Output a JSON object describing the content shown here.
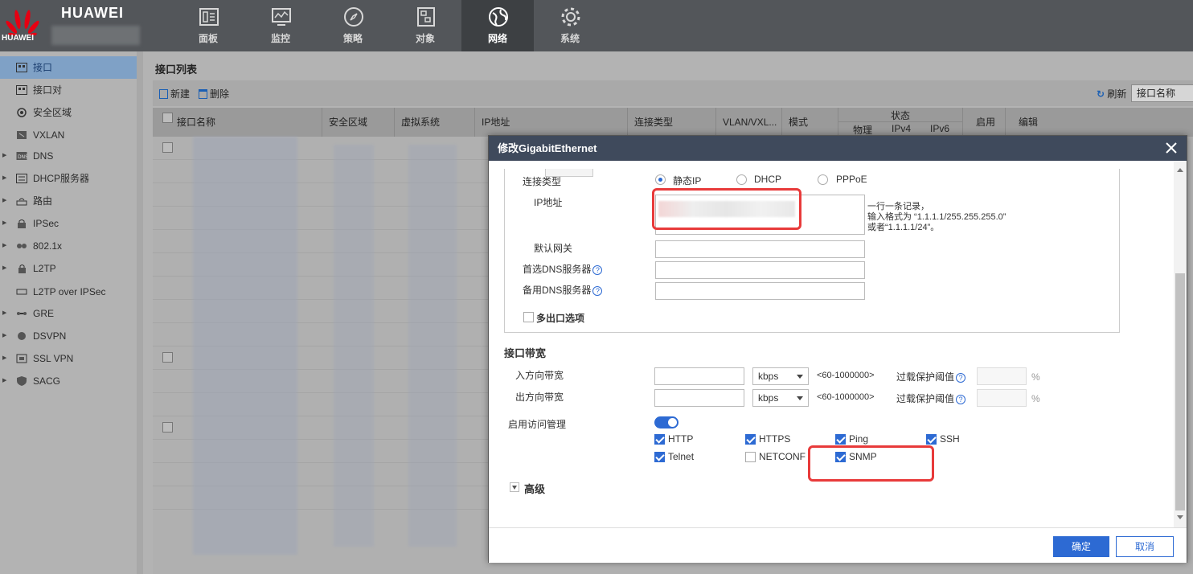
{
  "topbar": {
    "logo_text": "HUAWEI",
    "brand": "HUAWEI",
    "nav": [
      {
        "label": "面板",
        "icon": "dashboard-icon"
      },
      {
        "label": "监控",
        "icon": "monitor-icon"
      },
      {
        "label": "策略",
        "icon": "compass-icon"
      },
      {
        "label": "对象",
        "icon": "object-icon"
      },
      {
        "label": "网络",
        "icon": "globe-icon",
        "active": true
      },
      {
        "label": "系统",
        "icon": "gear-icon"
      }
    ]
  },
  "sidebar": {
    "items": [
      {
        "label": "接口",
        "active": true,
        "expandable": false
      },
      {
        "label": "接口对",
        "expandable": false
      },
      {
        "label": "安全区域",
        "expandable": false
      },
      {
        "label": "VXLAN",
        "expandable": false
      },
      {
        "label": "DNS",
        "expandable": true
      },
      {
        "label": "DHCP服务器",
        "expandable": true
      },
      {
        "label": "路由",
        "expandable": true
      },
      {
        "label": "IPSec",
        "expandable": true
      },
      {
        "label": "802.1x",
        "expandable": true
      },
      {
        "label": "L2TP",
        "expandable": true
      },
      {
        "label": "L2TP over IPSec",
        "expandable": false
      },
      {
        "label": "GRE",
        "expandable": true
      },
      {
        "label": "DSVPN",
        "expandable": true
      },
      {
        "label": "SSL VPN",
        "expandable": true
      },
      {
        "label": "SACG",
        "expandable": true
      }
    ]
  },
  "main": {
    "title": "接口列表",
    "new_label": "新建",
    "delete_label": "删除",
    "refresh_label": "刷新",
    "sort_value": "接口名称",
    "columns": {
      "name": "接口名称",
      "zone": "安全区域",
      "vsys": "虚拟系统",
      "ip": "IP地址",
      "conn_type": "连接类型",
      "vlan": "VLAN/VXL...",
      "mode": "模式",
      "status": "状态",
      "physical": "物理",
      "ipv4": "IPv4",
      "ipv6": "IPv6",
      "enable": "启用",
      "edit": "编辑"
    }
  },
  "dialog": {
    "title": "修改GigabitEthernet",
    "conn_type_label": "连接类型",
    "conn_options": [
      "静态IP",
      "DHCP",
      "PPPoE"
    ],
    "conn_selected": 0,
    "ip_label": "IP地址",
    "ip_hint_1": "一行一条记录，",
    "ip_hint_2": "输入格式为 “1.1.1.1/255.255.255.0”",
    "ip_hint_3": "或者“1.1.1.1/24”。",
    "gateway_label": "默认网关",
    "dns1_label": "首选DNS服务器",
    "dns2_label": "备用DNS服务器",
    "multi_exit_label": "多出口选项",
    "bandwidth_title": "接口带宽",
    "in_bw_label": "入方向带宽",
    "out_bw_label": "出方向带宽",
    "unit": "kbps",
    "range_hint": "<60-1000000>",
    "overload_label": "过载保护阈值",
    "percent": "%",
    "access_label": "启用访问管理",
    "access_enabled": true,
    "services": [
      {
        "label": "HTTP",
        "checked": true
      },
      {
        "label": "HTTPS",
        "checked": true
      },
      {
        "label": "Ping",
        "checked": true
      },
      {
        "label": "SSH",
        "checked": true
      },
      {
        "label": "Telnet",
        "checked": true
      },
      {
        "label": "NETCONF",
        "checked": false
      },
      {
        "label": "SNMP",
        "checked": true
      }
    ],
    "advanced_label": "高级",
    "ok_label": "确定",
    "cancel_label": "取消"
  },
  "colors": {
    "accent": "#2d6ad3",
    "highlight": "#e83a3a",
    "topbar": "#53565a",
    "dialog_header": "#3f4a5c"
  }
}
